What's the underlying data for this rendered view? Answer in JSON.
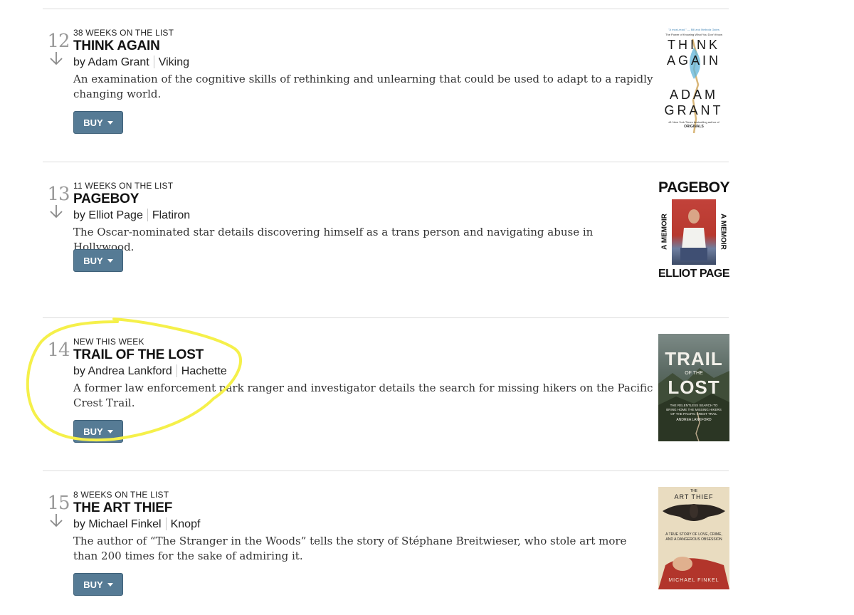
{
  "books": [
    {
      "rank": "12",
      "weeks": "38 WEEKS ON THE LIST",
      "title": "THINK AGAIN",
      "author": "by Adam Grant",
      "publisher": "Viking",
      "description": "An examination of the cognitive skills of rethinking and unlearning that could be used to adapt to a rapidly changing world.",
      "buy": "BUY",
      "cover": {
        "tagline": "The Power of Knowing What You Don't Know",
        "blurb": "\"A must-read.\" — Bill and Melinda Gates",
        "line1": "THINK",
        "line2": "AGAIN",
        "author1": "ADAM",
        "author2": "GRANT",
        "foot": "#1 New York Times bestselling author of",
        "foot2": "ORIGINALS"
      }
    },
    {
      "rank": "13",
      "weeks": "11 WEEKS ON THE LIST",
      "title": "PAGEBOY",
      "author": "by Elliot Page",
      "publisher": "Flatiron",
      "description": "The Oscar-nominated star details discovering himself as a trans person and navigating abuse in Hollywood.",
      "buy": "BUY",
      "cover": {
        "title": "PAGEBOY",
        "side": "A MEMOIR",
        "author": "ELLIOT PAGE"
      }
    },
    {
      "rank": "14",
      "weeks": "NEW THIS WEEK",
      "title": "TRAIL OF THE LOST",
      "author": "by Andrea Lankford",
      "publisher": "Hachette",
      "description": "A former law enforcement park ranger and investigator details the search for missing hikers on the Pacific Crest Trail.",
      "buy": "BUY",
      "cover": {
        "line1": "TRAIL",
        "line2": "OF THE",
        "line3": "LOST",
        "sub": "THE RELENTLESS SEARCH TO BRING HOME THE MISSING HIKERS OF THE PACIFIC CREST TRAIL",
        "author": "ANDREA LANKFORD"
      }
    },
    {
      "rank": "15",
      "weeks": "8 WEEKS ON THE LIST",
      "title": "THE ART THIEF",
      "author": "by Michael Finkel",
      "publisher": "Knopf",
      "description": "The author of “The Stranger in the Woods” tells the story of Stéphane Breitwieser, who stole art more than 200 times for the sake of admiring it.",
      "buy": "BUY",
      "cover": {
        "pre": "THE",
        "title": "ART THIEF",
        "sub": "A TRUE STORY OF LOVE, CRIME, AND A DANGEROUS OBSESSION",
        "author": "MICHAEL FINKEL"
      }
    }
  ],
  "colors": {
    "buy_button": "#567b95",
    "highlight": "#f5f04a",
    "rank": "#9a9a9a"
  }
}
